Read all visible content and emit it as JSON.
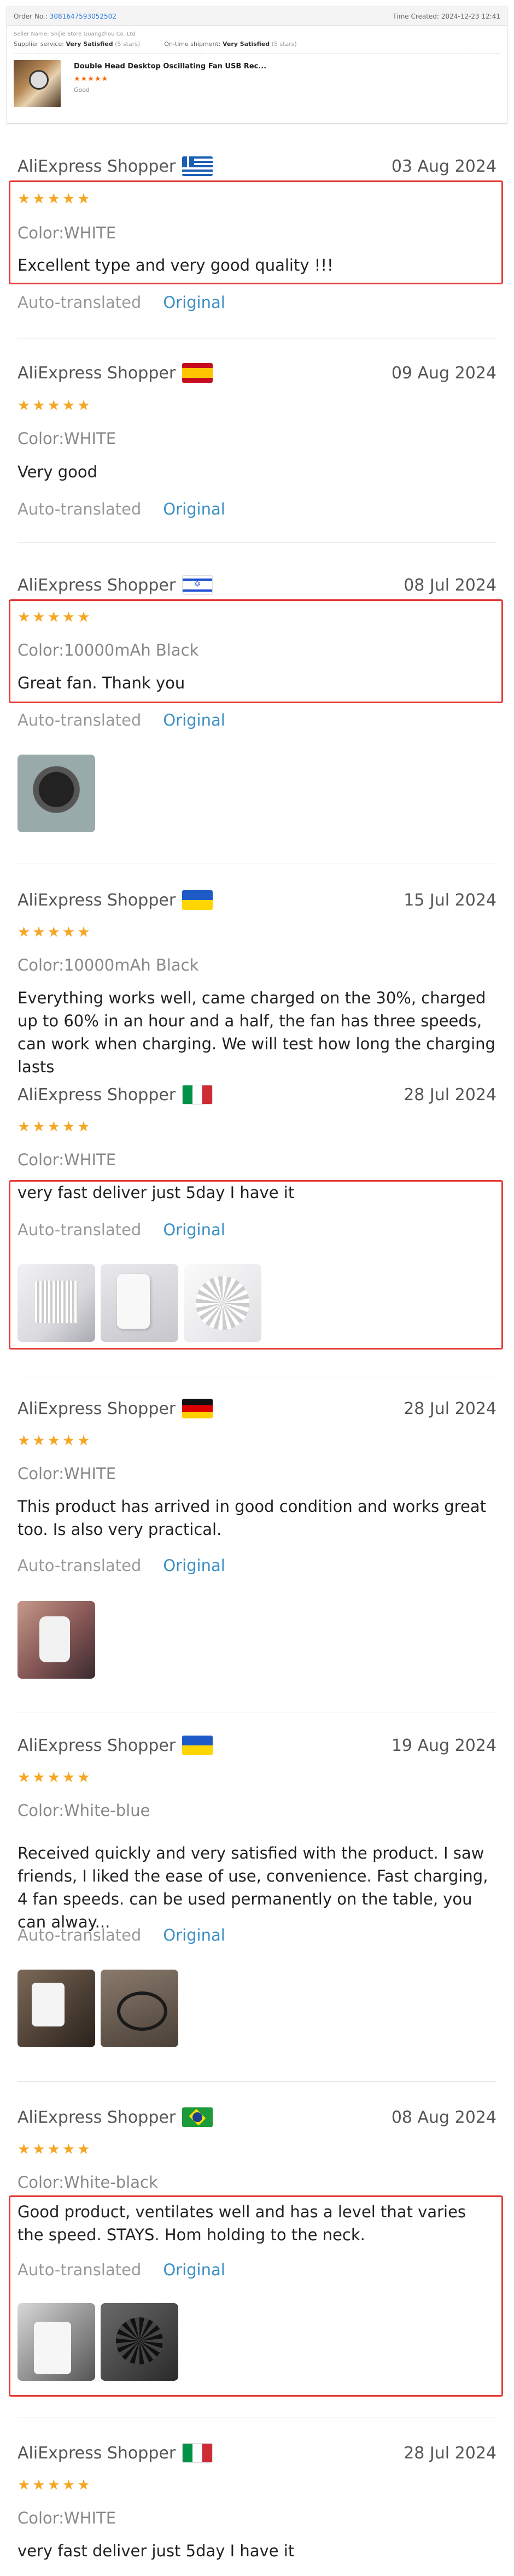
{
  "order": {
    "order_no_label": "Order No.:",
    "order_no": "3081647593052502",
    "time_label": "Time Created:",
    "time": "2024-12-23 12:41",
    "seller": "Seller Name: Shijie Store Guangzhou Co. Ltd",
    "supplier_label": "Supplier service:",
    "supplier_value": "Very Satisfied",
    "supplier_note": "(5 stars)",
    "shipment_label": "On-time shipment:",
    "shipment_value": "Very Satisfied",
    "shipment_note": "(5 stars)",
    "product_title": "Double Head Desktop Oscillating Fan USB Rec...",
    "product_stars": "★★★★★",
    "product_rating_label": "Good"
  },
  "reviews": [
    {
      "name": "AliExpress Shopper",
      "flag": "greece-flag",
      "date": "03 Aug 2024",
      "stars": "★★★★★",
      "color": "Color:WHITE",
      "text": "Excellent type and very good quality !!!",
      "auto": "Auto-translated",
      "original": "Original"
    },
    {
      "name": "AliExpress Shopper",
      "flag": "spain-flag",
      "date": "09 Aug 2024",
      "stars": "★★★★★",
      "color": "Color:WHITE",
      "text": "Very good",
      "auto": "Auto-translated",
      "original": "Original"
    },
    {
      "name": "AliExpress Shopper",
      "flag": "israel-flag",
      "date": "08 Jul 2024",
      "stars": "★★★★★",
      "color": "Color:10000mAh Black",
      "text": "Great fan. Thank you",
      "auto": "Auto-translated",
      "original": "Original"
    },
    {
      "name": "AliExpress Shopper",
      "flag": "ukraine-flag",
      "date": "15 Jul 2024",
      "stars": "★★★★★",
      "color": "Color:10000mAh Black",
      "text": "Everything works well, came charged on the 30%, charged up to 60% in an hour and a half, the fan has three speeds, can work when charging. We will test how long the charging lasts"
    },
    {
      "name": "AliExpress Shopper",
      "flag": "italy-flag",
      "date": "28 Jul 2024",
      "stars": "★★★★★",
      "color": "Color:WHITE",
      "text": "very fast deliver just 5day I have it",
      "auto": "Auto-translated",
      "original": "Original"
    },
    {
      "name": "AliExpress Shopper",
      "flag": "germany-flag",
      "date": "28 Jul 2024",
      "stars": "★★★★★",
      "color": "Color:WHITE",
      "text": "This product has arrived in good condition and works great too. Is also very practical.",
      "auto": "Auto-translated",
      "original": "Original"
    },
    {
      "name": "AliExpress Shopper",
      "flag": "ukraine-flag",
      "date": "19 Aug 2024",
      "stars": "★★★★★",
      "color": "Color:White-blue",
      "text": "Received quickly and very satisfied with the product. I saw friends, I liked the ease of use, convenience. Fast charging, 4 fan speeds. can be used permanently on the table, you can alway...",
      "auto": "Auto-translated",
      "original": "Original"
    },
    {
      "name": "AliExpress Shopper",
      "flag": "brazil-flag",
      "date": "08 Aug 2024",
      "stars": "★★★★★",
      "color": "Color:White-black",
      "text": "Good product, ventilates well and has a level that varies the speed. STAYS. Hom holding to the neck.",
      "auto": "Auto-translated",
      "original": "Original"
    },
    {
      "name": "AliExpress Shopper",
      "flag": "italy-flag",
      "date": "28 Jul 2024",
      "stars": "★★★★★",
      "color": "Color:WHITE",
      "text": "very fast deliver just 5day I have it"
    }
  ]
}
